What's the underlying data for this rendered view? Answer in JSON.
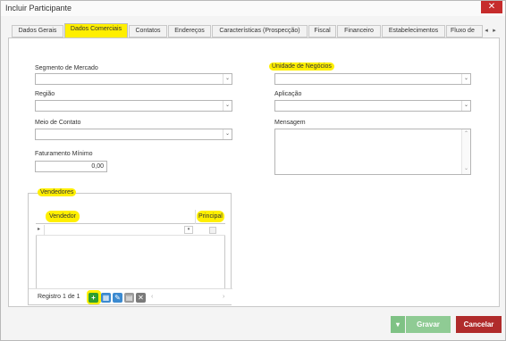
{
  "window": {
    "title": "Incluir Participante",
    "close_glyph": "✕"
  },
  "tabs": [
    {
      "label": "Dados Gerais"
    },
    {
      "label": "Dados Comerciais",
      "active": true
    },
    {
      "label": "Contatos"
    },
    {
      "label": "Endereços"
    },
    {
      "label": "Características (Prospecção)"
    },
    {
      "label": "Fiscal"
    },
    {
      "label": "Financeiro"
    },
    {
      "label": "Estabelecimentos"
    },
    {
      "label": "Fluxo de"
    }
  ],
  "form": {
    "segmento_label": "Segmento de Mercado",
    "regiao_label": "Região",
    "meio_contato_label": "Meio de Contato",
    "faturamento_label": "Faturamento Mínimo",
    "faturamento_value": "0,00",
    "unidade_label": "Unidade de Negócios",
    "aplicacao_label": "Aplicação",
    "mensagem_label": "Mensagem"
  },
  "vendedores": {
    "legend": "Vendedores",
    "col_vendedor": "Vendedor",
    "col_principal": "Principal",
    "pager_text": "Registro 1 de 1"
  },
  "footer": {
    "gravar": "Gravar",
    "cancelar": "Cancelar"
  },
  "colors": {
    "highlight": "#ffef00",
    "gravar_bg": "#8fcb94",
    "cancel_bg": "#b02b2b",
    "close_bg": "#c62c2c"
  }
}
